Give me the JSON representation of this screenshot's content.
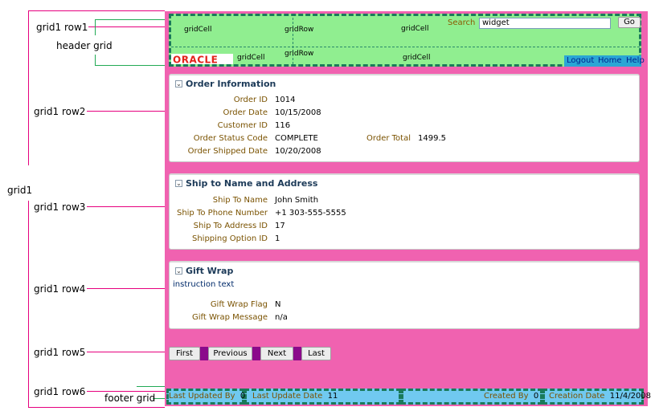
{
  "annotations": {
    "grid1": "grid1",
    "row1": "grid1 row1",
    "header_grid": "header grid",
    "row2": "grid1 row2",
    "row3": "grid1 row3",
    "row4": "grid1 row4",
    "row5": "grid1 row5",
    "row6": "grid1 row6",
    "footer_grid": "footer grid"
  },
  "header": {
    "cells": [
      "gridCell",
      "gridRow",
      "gridCell",
      "gridCell",
      "gridRow",
      "gridCell"
    ],
    "search_label": "Search",
    "search_value": "widget",
    "go_label": "Go",
    "logo_text": "ORACLE",
    "links": [
      "Logout",
      "Home",
      "Help"
    ]
  },
  "order_info": {
    "title": "Order Information",
    "fields": [
      {
        "label": "Order ID",
        "value": "1014"
      },
      {
        "label": "Order Date",
        "value": "10/15/2008"
      },
      {
        "label": "Customer ID",
        "value": "116"
      },
      {
        "label": "Order Status Code",
        "value": "COMPLETE"
      },
      {
        "label": "Order Shipped Date",
        "value": "10/20/2008"
      }
    ],
    "total_label": "Order Total",
    "total_value": "1499.5"
  },
  "ship_to": {
    "title": "Ship to Name and Address",
    "fields": [
      {
        "label": "Ship To Name",
        "value": "John Smith"
      },
      {
        "label": "Ship To Phone Number",
        "value": "+1 303-555-5555"
      },
      {
        "label": "Ship To Address ID",
        "value": "17"
      },
      {
        "label": "Shipping Option ID",
        "value": "1"
      }
    ]
  },
  "gift_wrap": {
    "title": "Gift Wrap",
    "instruction": "instruction text",
    "fields": [
      {
        "label": "Gift Wrap Flag",
        "value": "N"
      },
      {
        "label": "Gift Wrap Message",
        "value": "n/a"
      }
    ]
  },
  "nav": {
    "first": "First",
    "previous": "Previous",
    "next": "Next",
    "last": "Last"
  },
  "footer": {
    "last_updated_by_label": "Last Updated By",
    "last_updated_by_value": "0",
    "last_update_date_label": "Last Update Date",
    "last_update_date_value": "11",
    "created_by_label": "Created By",
    "created_by_value": "0",
    "creation_date_label": "Creation Date",
    "creation_date_value": "11/4/2008"
  },
  "colors": {
    "outer": "#f062b0",
    "header": "#90ee90",
    "footer": "#70c9f0",
    "annotation_line": "#e6007e"
  }
}
